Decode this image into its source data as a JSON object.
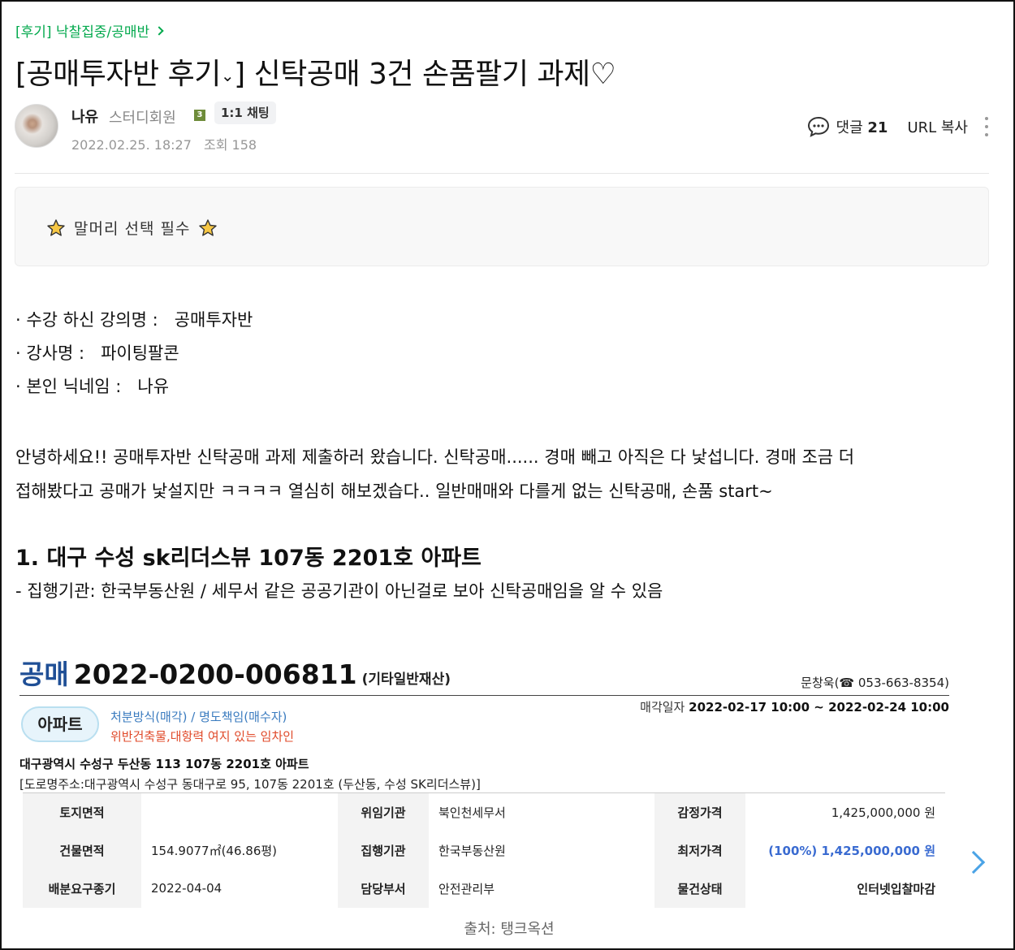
{
  "breadcrumb": {
    "text": "[후기] 낙찰집중/공매반"
  },
  "post": {
    "title_prefix": "[공매투자반 후기",
    "title_dropdown": "⌄",
    "title_suffix": "] 신탁공매 3건 손품팔기 과제♡"
  },
  "author": {
    "nickname": "나유",
    "grade": "스터디회원",
    "level": "3",
    "chat_label": "1:1 채팅",
    "date": "2022.02.25. 18:27",
    "views": "조회 158"
  },
  "actions": {
    "comment_label": "댓글",
    "comment_count": "21",
    "url_copy": "URL 복사"
  },
  "notice": {
    "text": "말머리 선택 필수"
  },
  "info": [
    {
      "label": "· 수강 하신 강의명 :",
      "value": "공매투자반"
    },
    {
      "label": "· 강사명 :",
      "value": "파이팅팔콘"
    },
    {
      "label": "· 본인 닉네임 :",
      "value": "나유"
    }
  ],
  "paragraph": {
    "line1": "안녕하세요!! 공매투자반 신탁공매 과제 제출하러 왔습니다. 신탁공매...... 경매 빼고 아직은 다 낯섭니다. 경매 조금 더",
    "line2": "접해봤다고 공매가 낯설지만 ㅋㅋㅋㅋ 열심히 해보겠습다.. 일반매매와 다를게 없는 신탁공매, 손품 start~"
  },
  "section1": {
    "heading": "1. 대구 수성 sk리더스뷰 107동 2201호 아파트",
    "note": "- 집행기관: 한국부동산원 / 세무서 같은 공공기관이 아닌걸로 보아 신탁공매임을 알 수 있음"
  },
  "embed": {
    "kind": "공매",
    "number": "2022-0200-006811",
    "category": "(기타일반재산)",
    "contact": "문창욱(☎ 053-663-8354)",
    "date_label": "매각일자",
    "date_value": "2022-02-17 10:00 ~ 2022-02-24 10:00",
    "badge": "아파트",
    "method": "처분방식(매각) / 명도책임(매수자)",
    "warning": "위반건축물,대항력 여지 있는 임차인",
    "address": "대구광역시 수성구 두산동 113 107동 2201호 아파트",
    "road_address": "[도로명주소:대구광역시 수성구 동대구로 95, 107동 2201호 (두산동, 수성 SK리더스뷰)]",
    "rows": [
      {
        "h1": "토지면적",
        "v1": "",
        "h2": "위임기관",
        "v2": "북인천세무서",
        "h3": "감정가격",
        "v3": "1,425,000,000 원"
      },
      {
        "h1": "건물면적",
        "v1": "154.9077㎡(46.86평)",
        "h2": "집행기관",
        "v2": "한국부동산원",
        "h3": "최저가격",
        "v3": "(100%) 1,425,000,000 원"
      },
      {
        "h1": "배분요구종기",
        "v1": "2022-04-04",
        "h2": "담당부서",
        "v2": "안전관리부",
        "h3": "물건상태",
        "v3": "인터넷입찰마감"
      }
    ]
  },
  "caption": "출처: 탱크옥션",
  "colors": {
    "accent_green": "#03a94d",
    "brand_blue": "#1f4f96",
    "warning_red": "#e04a2a"
  }
}
